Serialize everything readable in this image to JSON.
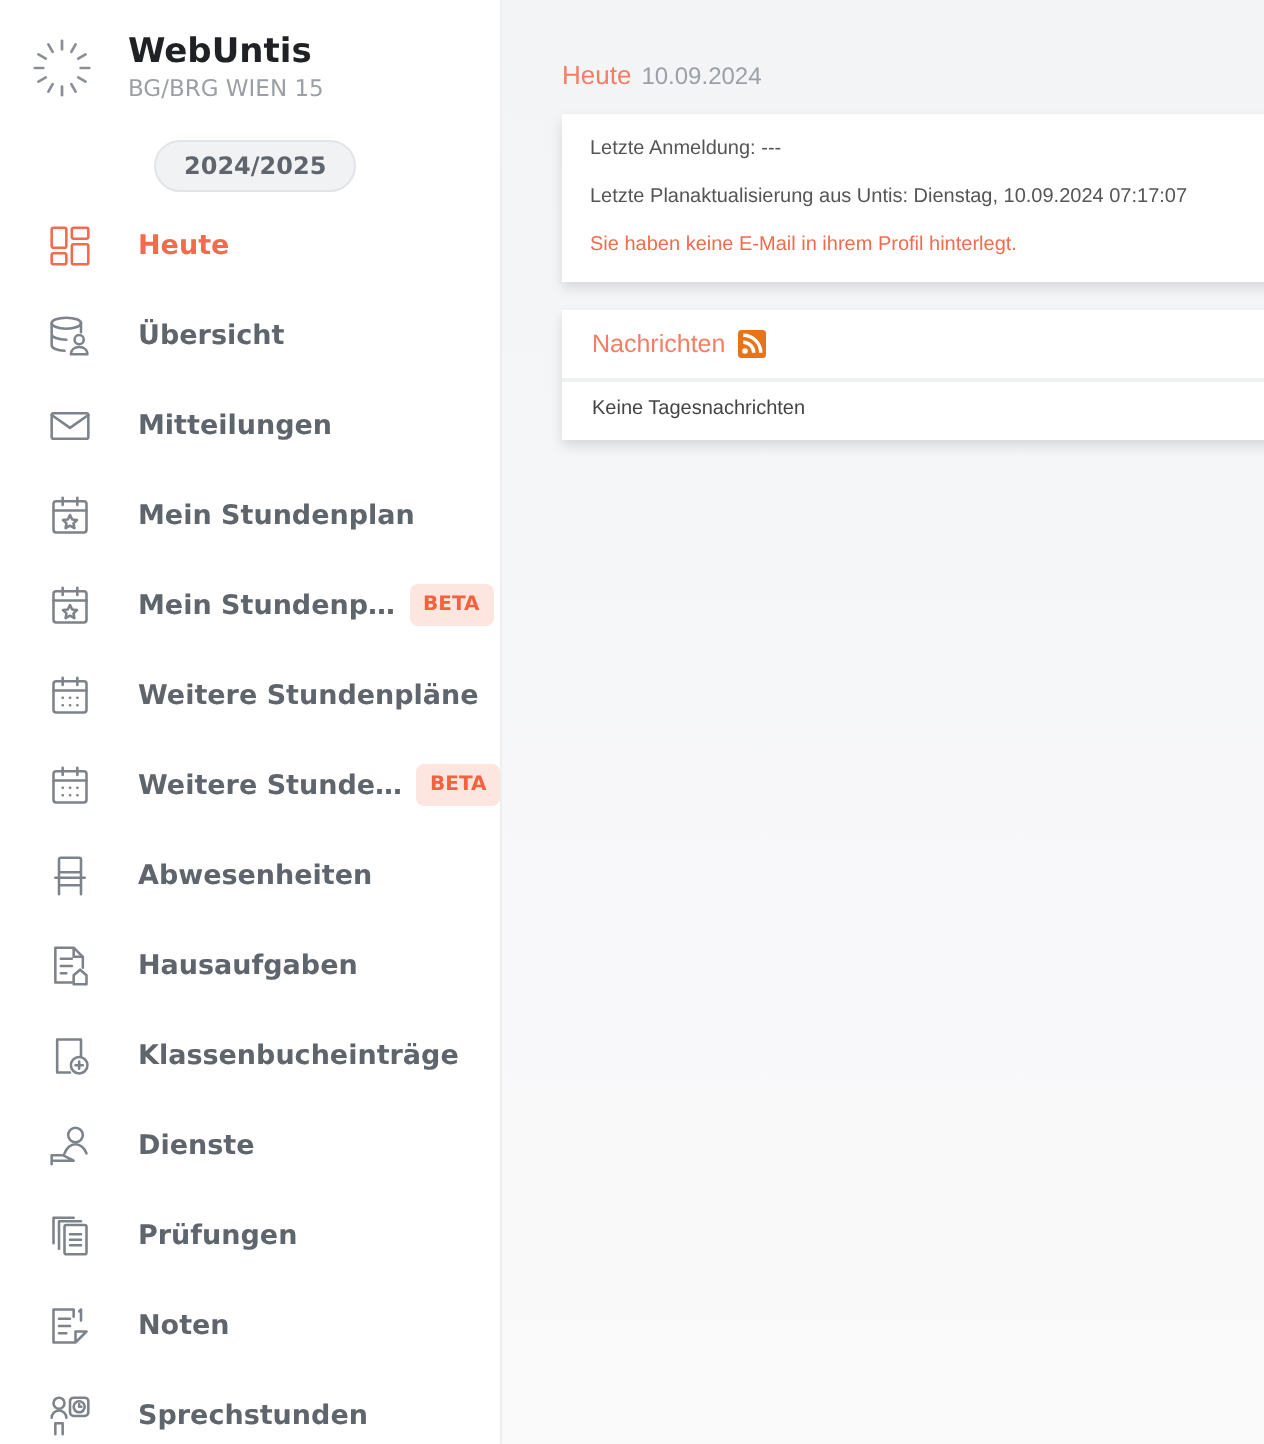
{
  "brand": {
    "name": "WebUntis",
    "school": "BG/BRG WIEN 15"
  },
  "school_year": "2024/2025",
  "nav": [
    {
      "label": "Heute",
      "kind": "dashboard",
      "selected": true
    },
    {
      "label": "Übersicht",
      "kind": "overview",
      "selected": false
    },
    {
      "label": "Mitteilungen",
      "kind": "mail",
      "selected": false
    },
    {
      "label": "Mein Stundenplan",
      "kind": "timetable",
      "selected": false
    },
    {
      "label": "Mein Stundenp…",
      "kind": "timetable",
      "selected": false,
      "badge": "BETA"
    },
    {
      "label": "Weitere Stundenpläne",
      "kind": "timetables",
      "selected": false
    },
    {
      "label": "Weitere Stunde…",
      "kind": "timetables",
      "selected": false,
      "badge": "BETA"
    },
    {
      "label": "Abwesenheiten",
      "kind": "absences",
      "selected": false
    },
    {
      "label": "Hausaufgaben",
      "kind": "homework",
      "selected": false
    },
    {
      "label": "Klassenbucheinträge",
      "kind": "classbook",
      "selected": false
    },
    {
      "label": "Dienste",
      "kind": "duties",
      "selected": false
    },
    {
      "label": "Prüfungen",
      "kind": "exams",
      "selected": false
    },
    {
      "label": "Noten",
      "kind": "grades",
      "selected": false
    },
    {
      "label": "Sprechstunden",
      "kind": "officehours",
      "selected": false
    }
  ],
  "page": {
    "title": "Heute",
    "date": "10.09.2024"
  },
  "info_card": {
    "lines": [
      {
        "text": "Letzte Anmeldung: ---",
        "kind": "normal"
      },
      {
        "text": "Letzte Planaktualisierung aus Untis: Dienstag, 10.09.2024 07:17:07",
        "kind": "normal"
      },
      {
        "text": "Sie haben keine E-Mail in ihrem Profil hinterlegt.",
        "kind": "warning"
      }
    ]
  },
  "news_card": {
    "title": "Nachrichten",
    "body": "Keine Tagesnachrichten"
  }
}
